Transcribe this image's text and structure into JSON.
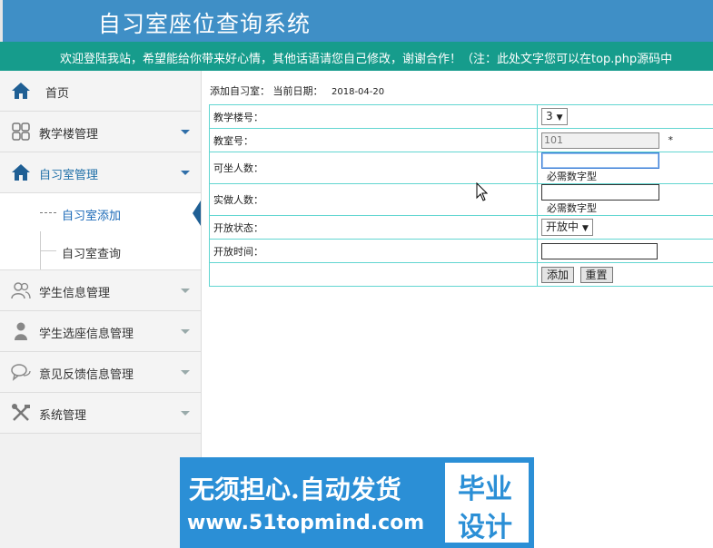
{
  "header": {
    "title": "自习室座位查询系统"
  },
  "notice": "欢迎登陆我站，希望能给你带来好心情，其他话语请您自己修改，谢谢合作！（注：此处文字您可以在top.php源码中",
  "sidebar": {
    "items": [
      {
        "label": "首页",
        "icon": "home-icon"
      },
      {
        "label": "教学楼管理",
        "icon": "grid-icon"
      },
      {
        "label": "自习室管理",
        "icon": "home-icon"
      },
      {
        "label": "学生信息管理",
        "icon": "users-icon"
      },
      {
        "label": "学生选座信息管理",
        "icon": "user-icon"
      },
      {
        "label": "意见反馈信息管理",
        "icon": "chat-icon"
      },
      {
        "label": "系统管理",
        "icon": "tools-icon"
      }
    ],
    "submenu": [
      {
        "label": "自习室添加"
      },
      {
        "label": "自习室查询"
      }
    ]
  },
  "page": {
    "breadcrumb": "添加自习室：",
    "date_label": "当前日期：",
    "date_value": "2018-04-20"
  },
  "form": {
    "building_label": "教学楼号：",
    "building_value": "3",
    "room_label": "教室号：",
    "room_value": "101",
    "room_required": "*",
    "seats_label": "可坐人数：",
    "seats_value": "",
    "seats_hint": "必需数字型",
    "actual_label": "实做人数：",
    "actual_value": "",
    "actual_hint": "必需数字型",
    "status_label": "开放状态：",
    "status_value": "开放中",
    "time_label": "开放时间：",
    "time_value": "",
    "add_button": "添加",
    "reset_button": "重置"
  },
  "banner": {
    "line1": "无须担心.自动发货",
    "line2": "www.51topmind.com",
    "right1": "毕业",
    "right2": "设计"
  },
  "colors": {
    "header": "#3f8fc6",
    "notice_bar": "#169c8c",
    "table_border": "#62d6d1",
    "banner": "#2b8fd6"
  }
}
